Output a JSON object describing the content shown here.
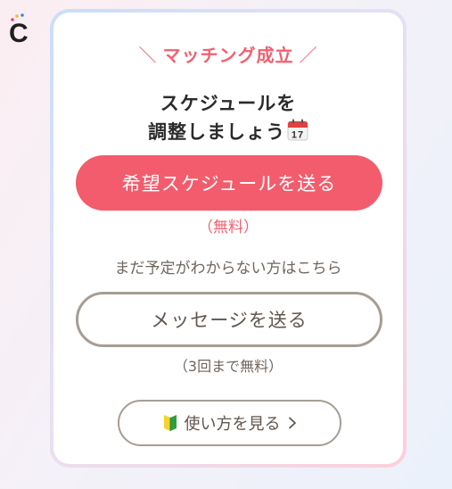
{
  "logo": {
    "letter": "C",
    "icon": "c-logo-icon",
    "colors": [
      "#1f1f1f",
      "#e94b5f",
      "#f6b73c",
      "#2d8fe0"
    ]
  },
  "card": {
    "match_prefix": "＼",
    "match_title": "マッチング成立",
    "match_suffix": "／",
    "headline_line1": "スケジュールを",
    "headline_line2": "調整しましょう",
    "calendar_day": "17",
    "calendar_icon": "calendar-icon",
    "primary_button": "希望スケジュールを送る",
    "free_note": "（無料）",
    "undecided_text": "まだ予定がわからない方はこちら",
    "secondary_button": "メッセージを送る",
    "limit_note": "（3回まで無料）",
    "howto_button": "使い方を見る",
    "howto_icon": "beginner-mark-icon",
    "howto_chevron": "chevron-right-icon"
  },
  "colors": {
    "accent": "#f25c6c",
    "outline": "#a59d94",
    "text_dark": "#2b2b2b",
    "text_muted": "#6f665e"
  }
}
